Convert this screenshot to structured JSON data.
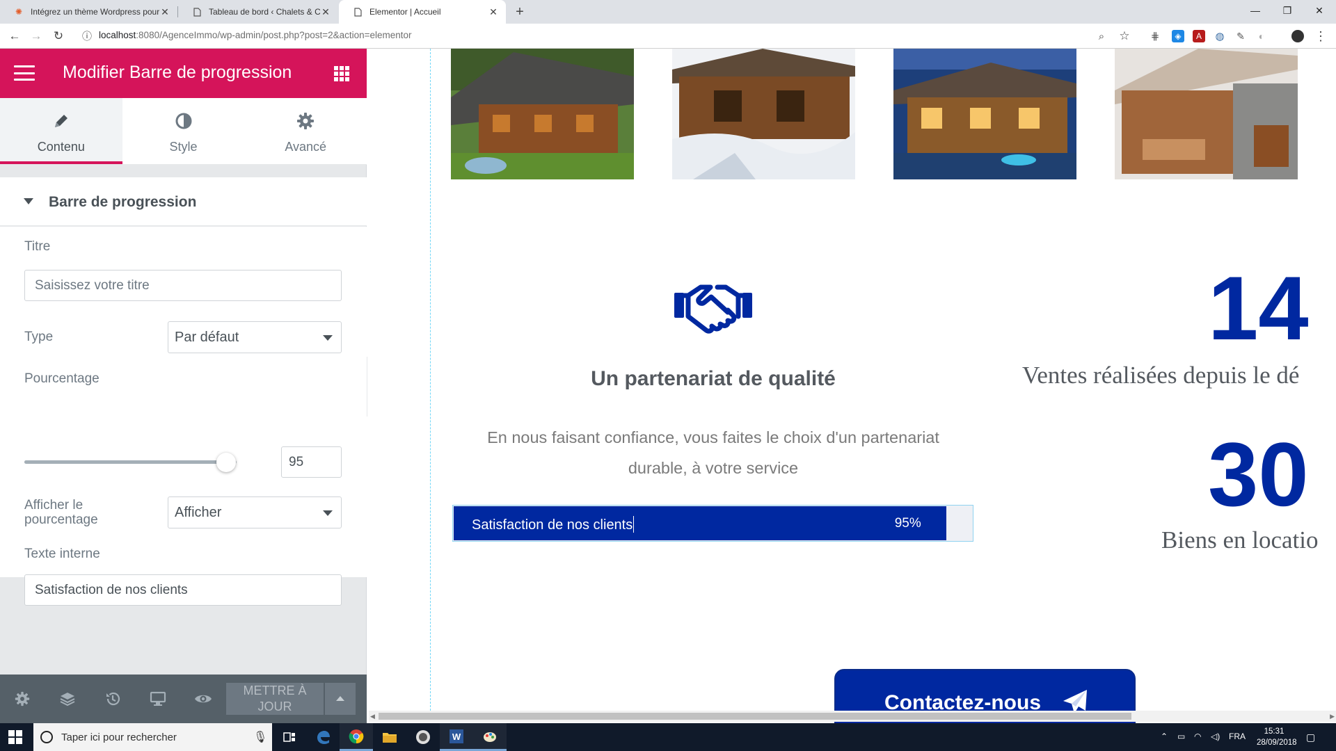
{
  "browser": {
    "tabs": [
      {
        "title": "Intégrez un thème Wordpress pour",
        "icon": "openclassrooms-icon"
      },
      {
        "title": "Tableau de bord ‹ Chalets & Caviar",
        "icon": "page-icon"
      },
      {
        "title": "Elementor | Accueil",
        "icon": "page-icon",
        "active": true
      }
    ],
    "new_tab": "+",
    "url_host": "localhost",
    "url_path": ":8080/AgenceImmo/wp-admin/post.php?post=2&action=elementor"
  },
  "panel": {
    "title": "Modifier Barre de progression",
    "tabs": [
      {
        "label": "Contenu",
        "icon": "pencil-icon",
        "active": true
      },
      {
        "label": "Style",
        "icon": "contrast-icon"
      },
      {
        "label": "Avancé",
        "icon": "gear-icon"
      }
    ],
    "section_title": "Barre de progression",
    "fields": {
      "title_label": "Titre",
      "title_placeholder": "Saisissez votre titre",
      "type_label": "Type",
      "type_value": "Par défaut",
      "percent_label": "Pourcentage",
      "percent_value": "95",
      "percent_slider": 95,
      "show_percent_label": "Afficher le pourcentage",
      "show_percent_value": "Afficher",
      "inner_text_label": "Texte interne",
      "inner_text_value": "Satisfaction de nos clients"
    },
    "footer": {
      "update_label": "METTRE À JOUR"
    }
  },
  "preview": {
    "feature_title": "Un partenariat de qualité",
    "feature_text_line1": "En nous faisant confiance, vous faites le choix d'un partenariat",
    "feature_text_line2": "durable, à votre service",
    "progress": {
      "inner_text": "Satisfaction de nos clients",
      "percent": 95,
      "percent_label": "95%",
      "bar_color": "#0028a0"
    },
    "counters": [
      {
        "number": "14",
        "label": "Ventes réalisées depuis le dé"
      },
      {
        "number": "30",
        "label": "Biens en locatio"
      }
    ],
    "contact_label": "Contactez-nous"
  },
  "taskbar": {
    "search_placeholder": "Taper ici pour rechercher",
    "lang": "FRA",
    "time": "15:31",
    "date": "28/09/2018"
  },
  "colors": {
    "elementor_pink": "#d5145a",
    "brand_blue": "#0028a0",
    "panel_footer": "#556068"
  }
}
